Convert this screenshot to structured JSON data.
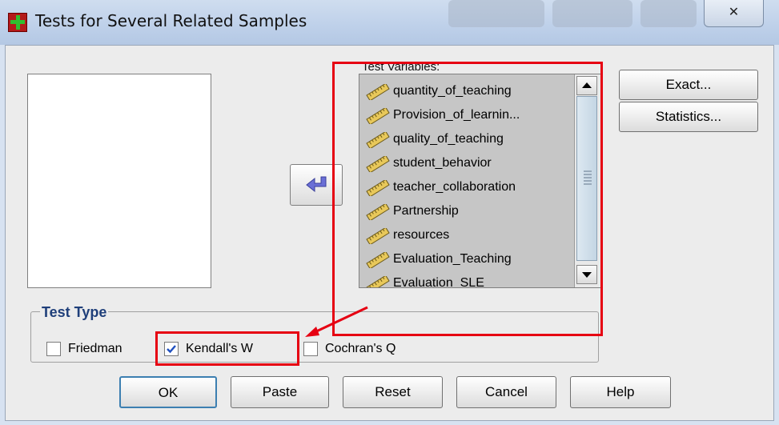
{
  "window": {
    "title": "Tests for Several Related Samples",
    "close_glyph": "✕"
  },
  "test_variables": {
    "label": "Test Variables:",
    "items": [
      "quantity_of_teaching",
      "Provision_of_learnin...",
      "quality_of_teaching",
      "student_behavior",
      "teacher_collaboration",
      "Partnership",
      "resources",
      "Evaluation_Teaching",
      "Evaluation_SLE"
    ]
  },
  "buttons": {
    "exact": "Exact...",
    "statistics": "Statistics...",
    "ok": "OK",
    "paste": "Paste",
    "reset": "Reset",
    "cancel": "Cancel",
    "help": "Help"
  },
  "test_type": {
    "title": "Test Type",
    "options": [
      {
        "label": "Friedman",
        "checked": false
      },
      {
        "label": "Kendall's W",
        "checked": true
      },
      {
        "label": "Cochran's Q",
        "checked": false
      }
    ]
  },
  "icons": {
    "app": "spss-dialog-icon",
    "move": "move-left-arrow-icon",
    "variable": "scale-ruler-icon",
    "close": "close-icon"
  },
  "colors": {
    "highlight": "#e60012",
    "arrow": "#6a6fd6",
    "group_title": "#1f3f7a"
  }
}
